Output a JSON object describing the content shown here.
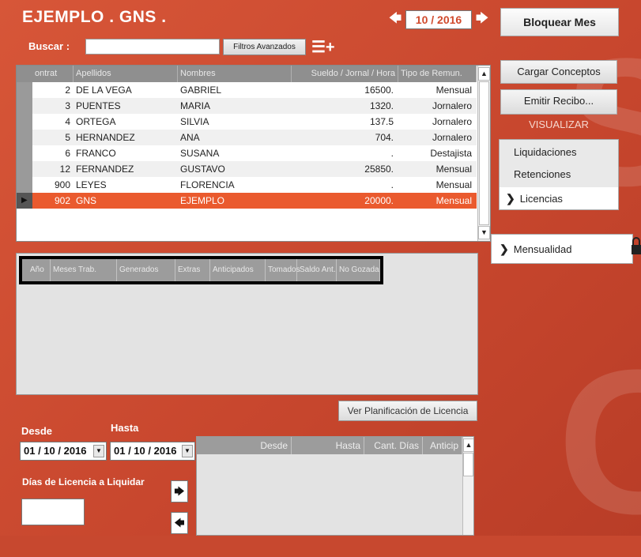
{
  "app": {
    "title": "EJEMPLO . GNS ."
  },
  "search": {
    "label": "Buscar :",
    "value": "",
    "filter_button": "Filtros Avanzados",
    "menu_icon": "list-add-icon"
  },
  "period": {
    "value": "10 / 2016",
    "prev_icon": "arrow-left-icon",
    "next_icon": "arrow-right-icon"
  },
  "lock_month_button": "Bloquear Mes",
  "employees": {
    "columns": [
      "ontrat",
      "Apellidos",
      "Nombres",
      "Sueldo / Jornal / Hora",
      "Tipo de Remun."
    ],
    "rows": [
      {
        "id": "2",
        "last": "DE LA VEGA",
        "first": "GABRIEL",
        "salary": "16500.",
        "type": "Mensual"
      },
      {
        "id": "3",
        "last": "PUENTES",
        "first": "MARIA",
        "salary": "1320.",
        "type": "Jornalero"
      },
      {
        "id": "4",
        "last": "ORTEGA",
        "first": "SILVIA",
        "salary": "137.5",
        "type": "Jornalero"
      },
      {
        "id": "5",
        "last": "HERNANDEZ",
        "first": "ANA",
        "salary": "704.",
        "type": "Jornalero"
      },
      {
        "id": "6",
        "last": "FRANCO",
        "first": "SUSANA",
        "salary": ".",
        "type": "Destajista"
      },
      {
        "id": "12",
        "last": "FERNANDEZ",
        "first": "GUSTAVO",
        "salary": "25850.",
        "type": "Mensual"
      },
      {
        "id": "900",
        "last": "LEYES",
        "first": "FLORENCIA",
        "salary": ".",
        "type": "Mensual"
      },
      {
        "id": "902",
        "last": "GNS",
        "first": "EJEMPLO",
        "salary": "20000.",
        "type": "Mensual"
      }
    ],
    "selected_index": 7
  },
  "licencias": {
    "columns": [
      "Año",
      "Meses Trab.",
      "Generados",
      "Extras",
      "Anticipados",
      "Tomados",
      "Saldo Ant.",
      "No Gozada"
    ]
  },
  "plan_button": "Ver Planificación de Licencia",
  "desde": {
    "label": "Desde",
    "value": "01 / 10 / 2016"
  },
  "hasta": {
    "label": "Hasta",
    "value": "01 / 10 / 2016"
  },
  "dias_label": "Días de Licencia a Liquidar",
  "dias_value": "",
  "detail_columns": [
    "Desde",
    "Hasta",
    "Cant. Días",
    "Anticip"
  ],
  "right_menu": {
    "cargar": "Cargar Conceptos",
    "emitir": "Emitir Recibo...",
    "visualizar": "VISUALIZAR",
    "items": [
      {
        "label": "Liquidaciones",
        "active": false
      },
      {
        "label": "Retenciones",
        "active": false
      },
      {
        "label": "Licencias",
        "active": true
      }
    ],
    "mensualidad": "Mensualidad"
  },
  "colors": {
    "accent": "#d04a2c",
    "selected_row": "#ea5a2e",
    "header_gray": "#8f8f8f"
  }
}
